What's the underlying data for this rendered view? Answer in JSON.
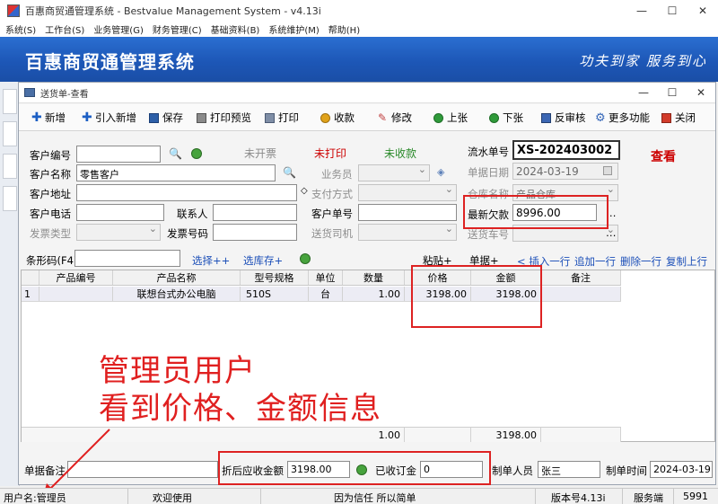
{
  "window": {
    "title": "百惠商贸通管理系统 - Bestvalue Management System - v4.13i"
  },
  "menu": [
    "系统(S)",
    "工作台(S)",
    "业务管理(G)",
    "财务管理(C)",
    "基础资料(B)",
    "系统维护(M)",
    "帮助(H)"
  ],
  "banner": {
    "name": "百惠商贸通管理系统",
    "slogan": "功夫到家  服务到心"
  },
  "inner": {
    "title": "送货单-查看"
  },
  "toolbar": {
    "new": "新增",
    "import_new": "引入新增",
    "save": "保存",
    "print_preview": "打印预览",
    "print": "打印",
    "receive": "收款",
    "edit": "修改",
    "prev": "上张",
    "next": "下张",
    "reverse_audit": "反审核",
    "more": "更多功能",
    "close": "关闭"
  },
  "form": {
    "customer_no_label": "客户编号",
    "customer_no": "",
    "customer_name_label": "客户名称",
    "customer_name": "零售客户",
    "customer_addr_label": "客户地址",
    "customer_addr": "",
    "customer_phone_label": "客户电话",
    "customer_phone": "",
    "contact_label": "联系人",
    "contact": "",
    "invoice_type_label": "发票类型",
    "invoice_type": "",
    "invoice_no_label": "发票号码",
    "invoice_no": "",
    "status_invoice": "未开票",
    "status_print": "未打印",
    "status_receive": "未收款",
    "salesman_label": "业务员",
    "salesman": "",
    "pay_method_label": "支付方式",
    "pay_method": "",
    "cust_order_label": "客户单号",
    "cust_order": "",
    "driver_label": "送货司机",
    "driver": "",
    "serial_label": "流水单号",
    "serial": "XS-202403002",
    "date_label": "单据日期",
    "date": "2024-03-19",
    "warehouse_label": "仓库名称",
    "warehouse": "产品仓库",
    "debt_label": "最新欠款",
    "debt": "8996.00",
    "truck_label": "送货车号",
    "truck": "",
    "view_status": "查看"
  },
  "barcode": {
    "label": "条形码(F4)",
    "value": ""
  },
  "actions": {
    "select": "选择++",
    "select_stock": "选库存+",
    "paste": "粘贴+",
    "single_paste": "单据+",
    "insert_row": "< 插入一行",
    "append_row": "追加一行",
    "delete_row": "删除一行",
    "copy_up": "复制上行"
  },
  "table": {
    "headers": [
      "",
      "产品编号",
      "产品名称",
      "型号规格",
      "单位",
      "数量",
      "价格",
      "金额",
      "备注"
    ],
    "rows": [
      {
        "idx": "1",
        "code": "",
        "name": "联想台式办公电脑",
        "model": "510S",
        "unit": "台",
        "qty": "1.00",
        "price": "3198.00",
        "amount": "3198.00",
        "remark": ""
      }
    ],
    "footer": {
      "qty": "1.00",
      "amount": "3198.00"
    }
  },
  "bottom": {
    "remark_label": "单据备注",
    "remark": "",
    "receivable_label": "折后应收金额",
    "receivable": "3198.00",
    "deposit_label": "已收订金",
    "deposit": "0",
    "maker_label": "制单人员",
    "maker": "张三",
    "make_time_label": "制单时间",
    "make_time": "2024-03-19"
  },
  "overlay": {
    "line1": "管理员用户",
    "line2": "看到价格、金额信息"
  },
  "status": {
    "user": "用户名:管理员",
    "welcome": "欢迎使用",
    "motto": "因为信任 所以简单",
    "version": "版本号4.13i",
    "server": "服务端",
    "port": "5991"
  },
  "colors": {
    "banner": "#1d57b7",
    "highlight": "#d22222",
    "overlay_text": "#e02020",
    "status_red": "#cc0000",
    "status_green": "#2a8a2a"
  }
}
